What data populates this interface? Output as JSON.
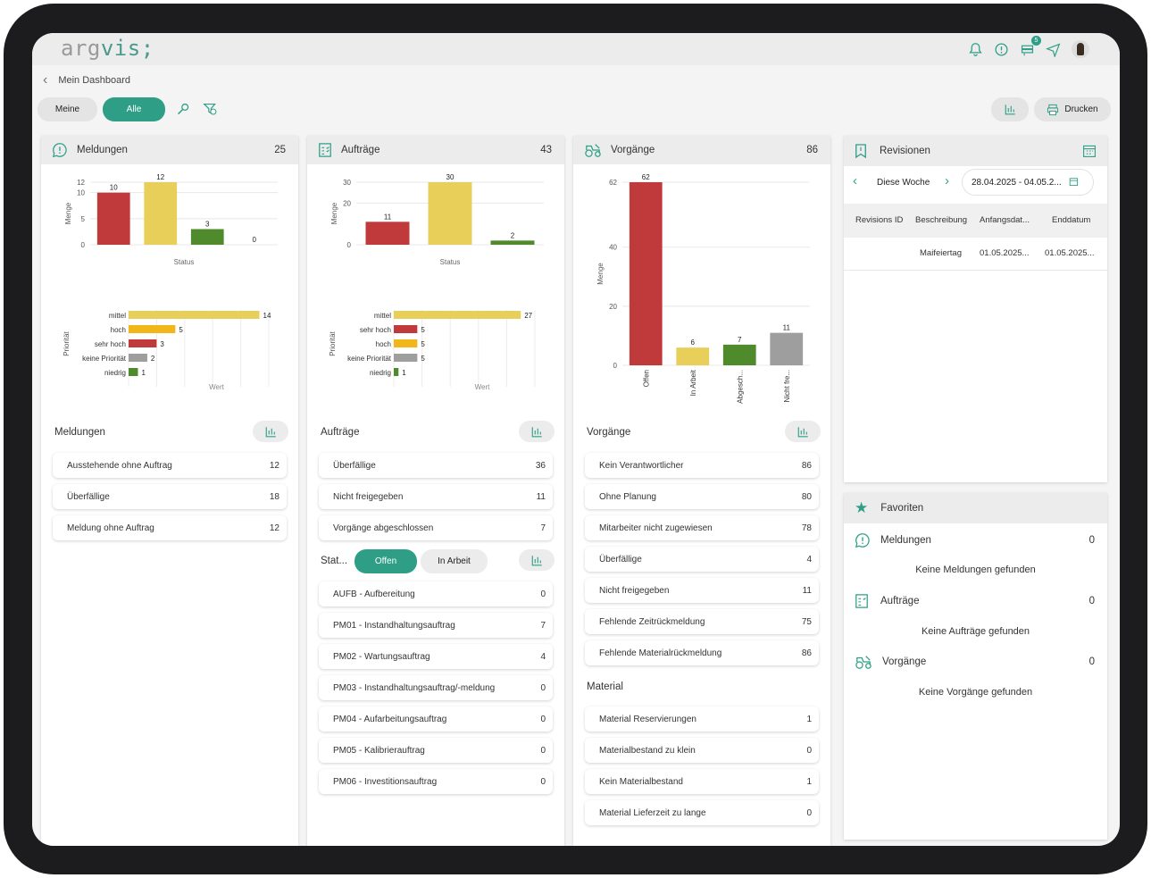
{
  "app": {
    "logo_left": "arg",
    "logo_right": "vis;",
    "notification_badge": "5"
  },
  "breadcrumb": {
    "title": "Mein Dashboard"
  },
  "filters": {
    "meine": "Meine",
    "alle": "Alle"
  },
  "toolbar": {
    "print_label": "Drucken"
  },
  "meldungen": {
    "title": "Meldungen",
    "count": "25",
    "chart_status": {
      "type": "bar",
      "ylabel": "Menge",
      "xlabel": "Status",
      "yticks": [
        "12",
        "10",
        "5",
        "0"
      ],
      "values": [
        10,
        12,
        3,
        0
      ],
      "colors": [
        "#c0393b",
        "#e7cf59",
        "#4f8a2c",
        "#cccccc"
      ]
    },
    "chart_prio": {
      "type": "bar",
      "orientation": "horizontal",
      "ylabel": "Priorität",
      "xlabel": "Wert",
      "categories": [
        "mittel",
        "hoch",
        "sehr hoch",
        "keine Priorität",
        "niedrig"
      ],
      "values": [
        14,
        5,
        3,
        2,
        1
      ],
      "colors": [
        "#e7cf59",
        "#f1b619",
        "#c0393b",
        "#9e9e9e",
        "#4f8a2c"
      ]
    },
    "section": "Meldungen",
    "rows": [
      {
        "label": "Ausstehende ohne Auftrag",
        "value": "12"
      },
      {
        "label": "Überfällige",
        "value": "18"
      },
      {
        "label": "Meldung ohne Auftrag",
        "value": "12"
      }
    ]
  },
  "auftraege": {
    "title": "Aufträge",
    "count": "43",
    "chart_status": {
      "type": "bar",
      "ylabel": "Menge",
      "xlabel": "Status",
      "yticks": [
        "30",
        "20",
        "0"
      ],
      "values": [
        11,
        30,
        2
      ],
      "colors": [
        "#c0393b",
        "#e7cf59",
        "#4f8a2c"
      ]
    },
    "chart_prio": {
      "type": "bar",
      "orientation": "horizontal",
      "ylabel": "Priorität",
      "xlabel": "Wert",
      "categories": [
        "mittel",
        "sehr hoch",
        "hoch",
        "keine Priorität",
        "niedrig"
      ],
      "values": [
        27,
        5,
        5,
        5,
        1
      ],
      "colors": [
        "#e7cf59",
        "#c0393b",
        "#f1b619",
        "#9e9e9e",
        "#4f8a2c"
      ]
    },
    "section": "Aufträge",
    "rows": [
      {
        "label": "Überfällige",
        "value": "36"
      },
      {
        "label": "Nicht freigegeben",
        "value": "11"
      },
      {
        "label": "Vorgänge abgeschlossen",
        "value": "7"
      }
    ],
    "status_label": "Stat...",
    "tab_offen": "Offen",
    "tab_arbeit": "In Arbeit",
    "type_rows": [
      {
        "label": "AUFB - Aufbereitung",
        "value": "0"
      },
      {
        "label": "PM01 - Instandhaltungsauftrag",
        "value": "7"
      },
      {
        "label": "PM02 - Wartungsauftrag",
        "value": "4"
      },
      {
        "label": "PM03 - Instandhaltungsauftrag/-meldung",
        "value": "0"
      },
      {
        "label": "PM04 - Aufarbeitungsauftrag",
        "value": "0"
      },
      {
        "label": "PM05 - Kalibrierauftrag",
        "value": "0"
      },
      {
        "label": "PM06 - Investitionsauftrag",
        "value": "0"
      }
    ]
  },
  "vorgaenge": {
    "title": "Vorgänge",
    "count": "86",
    "chart_status": {
      "type": "bar",
      "ylabel": "Menge",
      "xlabel": "Status",
      "yticks": [
        "62",
        "40",
        "20",
        "0"
      ],
      "categories": [
        "Offen",
        "In Arbeit",
        "Abgesch...",
        "Nicht fre..."
      ],
      "values": [
        62,
        6,
        7,
        11
      ],
      "colors": [
        "#c0393b",
        "#e7cf59",
        "#4f8a2c",
        "#9e9e9e"
      ]
    },
    "section": "Vorgänge",
    "rows": [
      {
        "label": "Kein Verantwortlicher",
        "value": "86"
      },
      {
        "label": "Ohne Planung",
        "value": "80"
      },
      {
        "label": "Mitarbeiter nicht zugewiesen",
        "value": "78"
      },
      {
        "label": "Überfällige",
        "value": "4"
      },
      {
        "label": "Nicht freigegeben",
        "value": "11"
      },
      {
        "label": "Fehlende Zeitrückmeldung",
        "value": "75"
      },
      {
        "label": "Fehlende Materialrückmeldung",
        "value": "86"
      }
    ],
    "material_section": "Material",
    "material_rows": [
      {
        "label": "Material Reservierungen",
        "value": "1"
      },
      {
        "label": "Materialbestand zu klein",
        "value": "0"
      },
      {
        "label": "Kein Materialbestand",
        "value": "1"
      },
      {
        "label": "Material Lieferzeit zu lange",
        "value": "0"
      }
    ]
  },
  "revisionen": {
    "title": "Revisionen",
    "week": "Diese Woche",
    "daterange": "28.04.2025 - 04.05.2...",
    "columns": [
      "Revisions ID",
      "Beschreibung",
      "Anfangsdat...",
      "Enddatum"
    ],
    "rows": [
      {
        "id": "",
        "desc": "Maifeiertag",
        "start": "01.05.2025...",
        "end": "01.05.2025..."
      }
    ]
  },
  "favoriten": {
    "title": "Favoriten",
    "items": [
      {
        "label": "Meldungen",
        "count": "0",
        "empty": "Keine Meldungen gefunden"
      },
      {
        "label": "Aufträge",
        "count": "0",
        "empty": "Keine Aufträge gefunden"
      },
      {
        "label": "Vorgänge",
        "count": "0",
        "empty": "Keine Vorgänge gefunden"
      }
    ]
  },
  "chart_data": [
    {
      "type": "bar",
      "ylabel": "Menge",
      "xlabel": "Status",
      "categories": [
        "",
        "",
        "",
        ""
      ],
      "values": [
        10,
        12,
        3,
        0
      ],
      "ylim": [
        0,
        12
      ]
    },
    {
      "type": "bar",
      "orientation": "horizontal",
      "ylabel": "Priorität",
      "xlabel": "Wert",
      "categories": [
        "mittel",
        "hoch",
        "sehr hoch",
        "keine Priorität",
        "niedrig"
      ],
      "values": [
        14,
        5,
        3,
        2,
        1
      ]
    },
    {
      "type": "bar",
      "ylabel": "Menge",
      "xlabel": "Status",
      "categories": [
        "",
        "",
        ""
      ],
      "values": [
        11,
        30,
        2
      ],
      "ylim": [
        0,
        30
      ]
    },
    {
      "type": "bar",
      "orientation": "horizontal",
      "ylabel": "Priorität",
      "xlabel": "Wert",
      "categories": [
        "mittel",
        "sehr hoch",
        "hoch",
        "keine Priorität",
        "niedrig"
      ],
      "values": [
        27,
        5,
        5,
        5,
        1
      ]
    },
    {
      "type": "bar",
      "ylabel": "Menge",
      "xlabel": "Status",
      "categories": [
        "Offen",
        "In Arbeit",
        "Abgesch...",
        "Nicht fre..."
      ],
      "values": [
        62,
        6,
        7,
        11
      ],
      "ylim": [
        0,
        62
      ]
    }
  ]
}
